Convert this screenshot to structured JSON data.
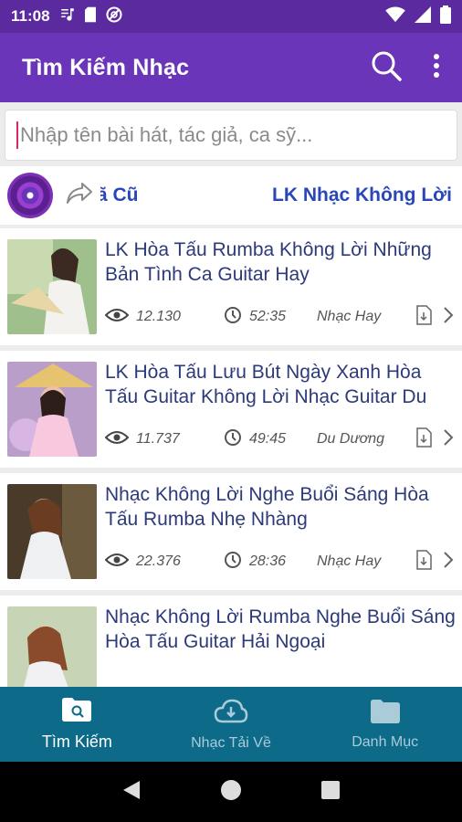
{
  "status": {
    "time": "11:08",
    "icons_left": [
      "music-note-icon",
      "sd-card-icon",
      "no-signal-icon"
    ],
    "icons_right": [
      "wifi-icon",
      "cell-signal-icon",
      "battery-icon"
    ]
  },
  "app_bar": {
    "title": "Tìm Kiếm Nhạc",
    "actions": [
      "search-icon",
      "more-vert-icon"
    ]
  },
  "search": {
    "placeholder": "Nhập tên bài hát, tác giả, ca sỹ..."
  },
  "chips": {
    "items": [
      "ã Cũ",
      "LK Nhạc Không Lời"
    ]
  },
  "songs": [
    {
      "title": "LK Hòa Tấu Rumba Không Lời Những Bản Tình Ca Guitar Hay",
      "views": "12.130",
      "duration": "52:35",
      "artist": "Nhạc Hay"
    },
    {
      "title": "LK Hòa Tấu Lưu Bút Ngày Xanh Hòa Tấu Guitar Không Lời Nhạc Guitar Du",
      "views": "11.737",
      "duration": "49:45",
      "artist": "Du Dương"
    },
    {
      "title": "Nhạc Không Lời Nghe Buổi Sáng Hòa Tấu Rumba Nhẹ Nhàng",
      "views": "22.376",
      "duration": "28:36",
      "artist": "Nhạc Hay"
    },
    {
      "title": "Nhạc Không Lời Rumba Nghe Buổi Sáng Hòa Tấu Guitar Hải Ngoại",
      "views": "",
      "duration": "",
      "artist": ""
    }
  ],
  "bottom_nav": {
    "items": [
      {
        "label": "Tìm Kiếm",
        "icon": "folder-search-icon",
        "active": true
      },
      {
        "label": "Nhạc Tải Về",
        "icon": "cloud-download-icon",
        "active": false
      },
      {
        "label": "Danh Mục",
        "icon": "folder-icon",
        "active": false
      }
    ]
  },
  "colors": {
    "status_bar": "#5b2a9f",
    "app_bar": "#6a35b8",
    "title_text": "#2c3a7a",
    "chip_text": "#2a47b8",
    "bottom_nav": "#0d6a88"
  }
}
